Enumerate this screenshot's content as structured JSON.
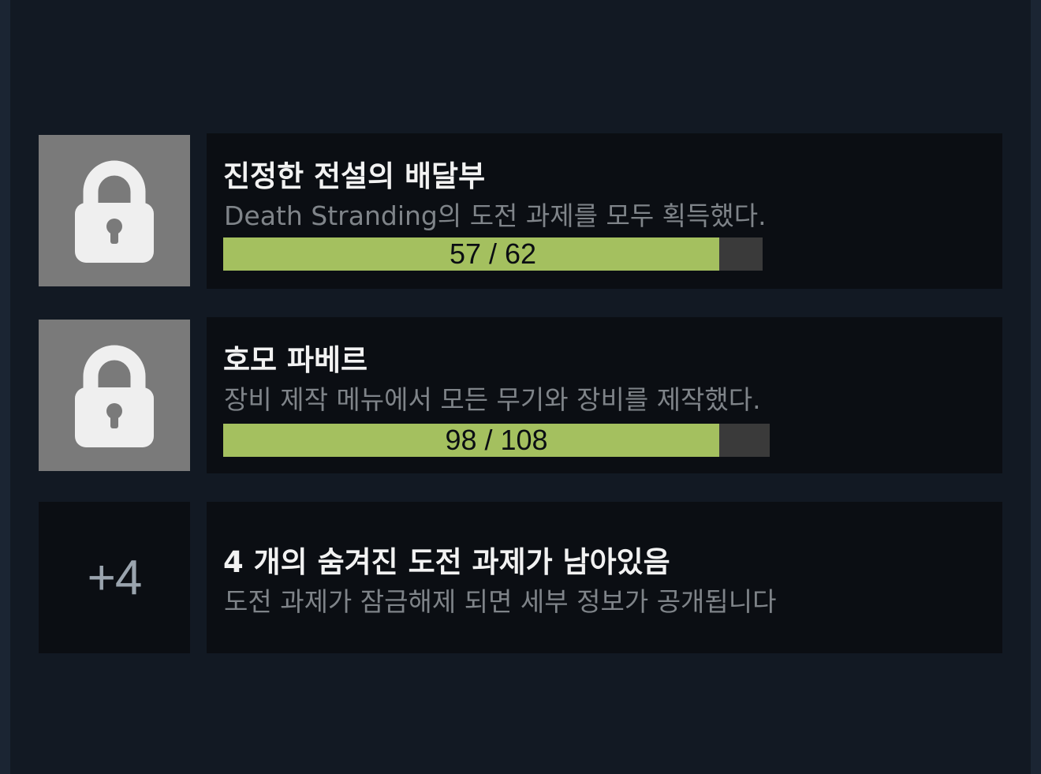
{
  "achievements": [
    {
      "title": "진정한 전설의 배달부",
      "description": "Death Stranding의 도전 과제를 모두 획득했다.",
      "progress_text": "57 / 62",
      "progress_fraction": 0.919,
      "icon": "lock-icon"
    },
    {
      "title": "호모 파베르",
      "description": "장비 제작 메뉴에서 모든 무기와 장비를 제작했다.",
      "progress_text": "98 / 108",
      "progress_fraction": 0.907,
      "icon": "lock-icon"
    }
  ],
  "hidden": {
    "count_label": "+4",
    "title": "4 개의 숨겨진 도전 과제가 남아있음",
    "description": "도전 과제가 잠금해제 되면 세부 정보가 공개됩니다"
  },
  "colors": {
    "progress_fill": "#a4c05f",
    "progress_track": "#3a3a3a",
    "card_bg": "#0b0e13",
    "page_bg": "#121923",
    "locked_icon_bg": "#7a7a7a"
  }
}
